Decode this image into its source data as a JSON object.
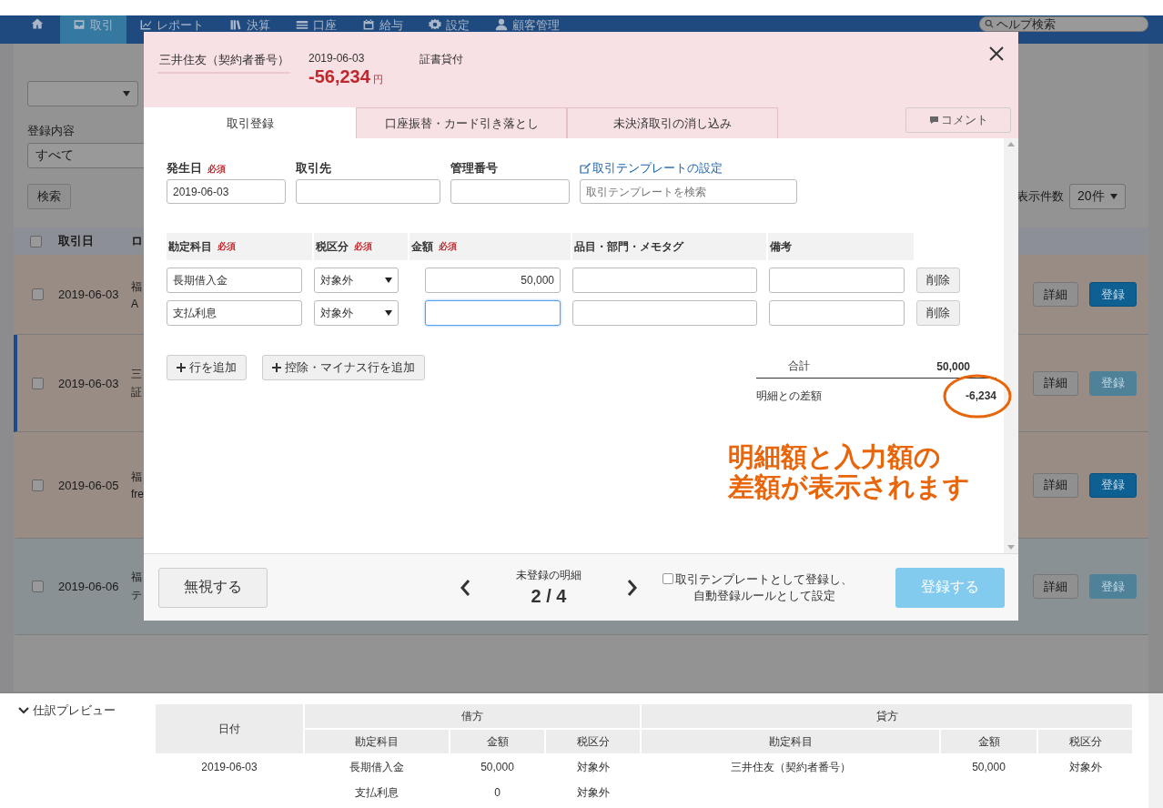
{
  "nav": {
    "items": [
      {
        "kind": "icon",
        "selected": false
      },
      {
        "kind": "text",
        "label": "取引",
        "selected": true
      },
      {
        "kind": "text",
        "label": "レポート",
        "selected": false
      },
      {
        "kind": "text",
        "label": "決算",
        "selected": false
      },
      {
        "kind": "text",
        "label": "口座",
        "selected": false
      },
      {
        "kind": "text",
        "label": "給与",
        "selected": false
      },
      {
        "kind": "text",
        "label": "設定",
        "selected": false
      },
      {
        "kind": "text",
        "label": "顧客管理",
        "selected": false
      }
    ],
    "search": {
      "placeholder": "ヘルプ検索"
    }
  },
  "filters": {
    "content_label": "登録内容",
    "content_value": "すべて",
    "search_button": "検索",
    "page_size_label": "表示件数",
    "page_size_value": "20件"
  },
  "list": {
    "all_checked": false,
    "columns": [
      "取引日",
      "ロ"
    ],
    "rows": [
      {
        "date": "2019-06-03",
        "line_1": "福",
        "line_2": "A",
        "color": "#988c85",
        "checked": false,
        "selected": false,
        "detail_button": "詳細",
        "register_button": "登録",
        "register_disabled": false
      },
      {
        "date": "2019-06-03",
        "line_1": "三",
        "line_2": "証",
        "color": "#988c85",
        "checked": false,
        "selected": true,
        "detail_button": "詳細",
        "register_button": "登録",
        "register_disabled": true
      },
      {
        "date": "2019-06-05",
        "line_1": "福",
        "line_2": "fre",
        "color": "#988c85",
        "checked": false,
        "selected": false,
        "detail_button": "詳細",
        "register_button": "登録",
        "register_disabled": false
      },
      {
        "date": "2019-06-06",
        "line_1": "福",
        "line_2": "テ",
        "color": "#899194",
        "checked": false,
        "selected": false,
        "detail_button": "詳細",
        "register_button": "登録",
        "register_disabled": true
      }
    ]
  },
  "modal": {
    "account": "三井住友（契約者番号）",
    "date": "2019-06-03",
    "amount": "-56,234",
    "currency": "円",
    "description": "証書貸付",
    "tabs": [
      {
        "label": "取引登録",
        "selected": true
      },
      {
        "label": "口座振替・カード引き落とし",
        "selected": false
      },
      {
        "label": "未決済取引の消し込み",
        "selected": false
      }
    ],
    "comment_button": "コメント",
    "fields": [
      {
        "label": "発生日",
        "required_mark": "必須",
        "value": "2019-06-03"
      },
      {
        "label": "取引先"
      },
      {
        "label": "管理番号"
      }
    ],
    "template_link": "取引テンプレートの設定",
    "template_search": {
      "placeholder": "取引テンプレートを検索"
    },
    "line_columns": [
      {
        "label": "勘定科目",
        "required_mark": "必須"
      },
      {
        "label": "税区分",
        "required_mark": "必須"
      },
      {
        "label": "金額",
        "required_mark": "必須"
      },
      {
        "label": "品目・部門・メモタグ"
      },
      {
        "label": "備考"
      }
    ],
    "lines": [
      {
        "account": "長期借入金",
        "tax": "対象外",
        "amount": "50,000",
        "focused": false,
        "delete_button": "削除"
      },
      {
        "account": "支払利息",
        "tax": "対象外",
        "focused": true,
        "delete_button": "削除"
      }
    ],
    "add_row_button": "行を追加",
    "add_minus_row_button": "控除・マイナス行を追加",
    "totals": {
      "total_label": "合計",
      "total": "50,000",
      "difference_label": "明細との差額",
      "difference": "-6,234"
    },
    "annotation": [
      "明細額と入力額の",
      "差額が表示されます"
    ],
    "ignore_button": "無視する",
    "pager": {
      "label": "未登録の明細",
      "position": "2 / 4"
    },
    "template_checkbox": {
      "lines": [
        "取引テンプレートとして登録し、",
        "自動登録ルールとして設定"
      ],
      "checked": false
    },
    "submit_button": {
      "label": "登録する",
      "disabled": true
    }
  },
  "preview": {
    "toggle": {
      "label": "仕訳プレビュー",
      "expanded": true
    },
    "date_header": "日付",
    "debit_header": "借方",
    "credit_header": "貸方",
    "sub_columns": [
      "勘定科目",
      "金額",
      "税区分",
      "勘定科目",
      "金額",
      "税区分"
    ],
    "rows": [
      {
        "date": "2019-06-03",
        "debit": [
          "長期借入金",
          "50,000",
          "対象外"
        ],
        "credit": [
          "三井住友（契約者番号）",
          "50,000",
          "対象外"
        ]
      },
      {
        "debit": [
          "支払利息",
          "0",
          "対象外"
        ]
      }
    ]
  }
}
